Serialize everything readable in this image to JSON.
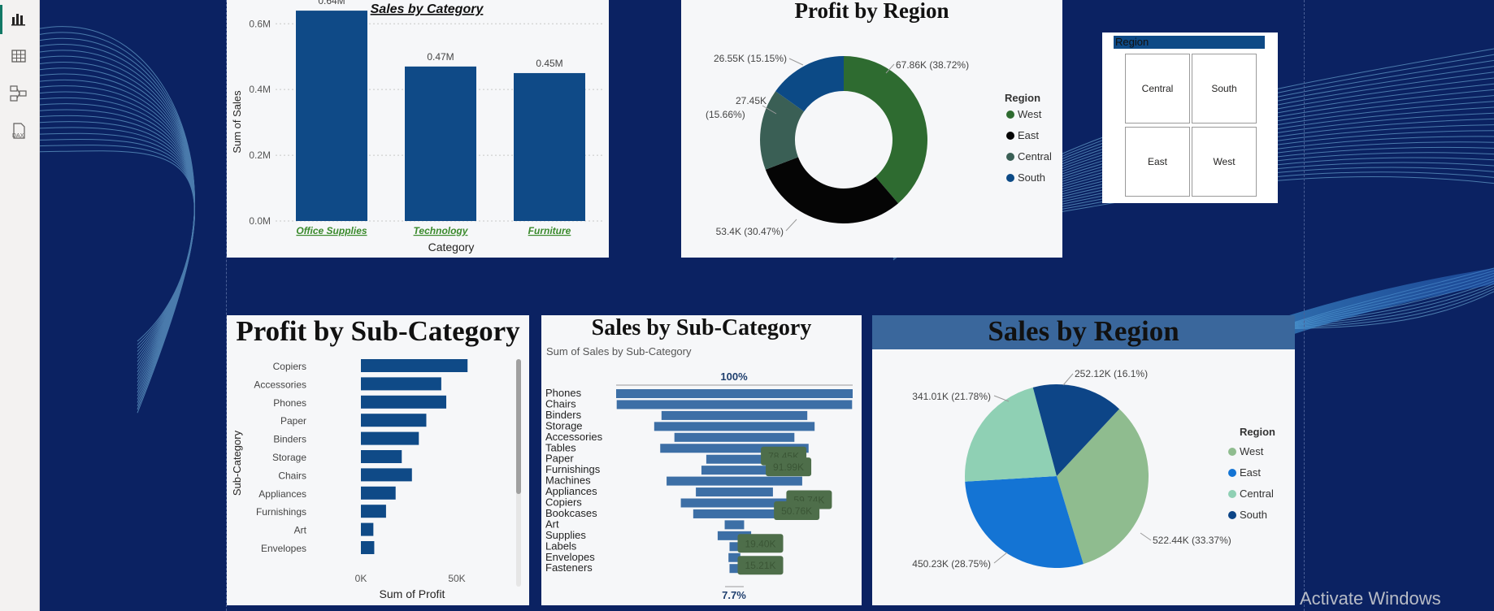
{
  "rail": {
    "items": [
      {
        "name": "report-view-icon",
        "active": true
      },
      {
        "name": "table-view-icon",
        "active": false
      },
      {
        "name": "model-view-icon",
        "active": false
      },
      {
        "name": "dax-query-view-icon",
        "active": false,
        "label": "DAX"
      }
    ]
  },
  "colors": {
    "canvas_bg": "#0b2262",
    "bar_dark": "#0f4a87",
    "funnel": "#3d6fa6",
    "west_green": "#2e6b30",
    "east_black": "#050505",
    "central_gray_green": "#3a5f55",
    "south_blue": "#0c4a86",
    "pie_west": "#8fbc8f",
    "pie_east": "#1474d4",
    "pie_central": "#8fd0b4",
    "pie_south": "#0d4587"
  },
  "sales_by_category": {
    "title": "Sales by Category",
    "ylabel": "Sum of Sales",
    "xlabel": "Category",
    "y_ticks": [
      "0.6M",
      "0.4M",
      "0.2M",
      "0.0M"
    ]
  },
  "profit_by_region": {
    "title": "Profit by Region",
    "legend_title": "Region",
    "labels": {
      "west": "67.86K (38.72%)",
      "east": "53.4K (30.47%)",
      "central_1": "27.45K",
      "central_2": "(15.66%)",
      "south": "26.55K (15.15%)"
    }
  },
  "region_slicer": {
    "header": "Region",
    "tiles": [
      "Central",
      "South",
      "East",
      "West"
    ]
  },
  "profit_by_subcategory": {
    "title": "Profit by Sub-Category",
    "ylabel": "Sub-Category",
    "xlabel": "Sum of Profit",
    "x_ticks": [
      "0K",
      "50K"
    ]
  },
  "sales_by_subcategory": {
    "title": "Sales by Sub-Category",
    "subtitle": "Sum of Sales by Sub-Category",
    "top_pct": "100%",
    "bottom_pct": "7.7%"
  },
  "sales_by_region": {
    "title": "Sales by Region",
    "legend_title": "Region",
    "labels": {
      "south": "252.12K (16.1%)",
      "central": "341.01K (21.78%)",
      "west": "522.44K (33.37%)",
      "east": "450.23K (28.75%)"
    }
  },
  "watermark": "Activate Windows",
  "chart_data": [
    {
      "type": "bar",
      "title": "Sales by Category",
      "xlabel": "Category",
      "ylabel": "Sum of Sales",
      "categories": [
        "Office Supplies",
        "Technology",
        "Furniture"
      ],
      "values": [
        0.64,
        0.47,
        0.45
      ],
      "data_labels": [
        "0.64M",
        "0.47M",
        "0.45M"
      ],
      "unit": "M",
      "ylim": [
        0,
        0.66
      ],
      "grid": true
    },
    {
      "type": "pie",
      "variant": "donut",
      "title": "Profit by Region",
      "categories": [
        "West",
        "East",
        "Central",
        "South"
      ],
      "values": [
        67.86,
        53.4,
        27.45,
        26.55
      ],
      "percents": [
        38.72,
        30.47,
        15.66,
        15.15
      ],
      "legend": "right"
    },
    {
      "type": "bar",
      "orientation": "horizontal",
      "title": "Profit by Sub-Category",
      "xlabel": "Sum of Profit",
      "ylabel": "Sub-Category",
      "categories": [
        "Copiers",
        "Accessories",
        "Phones",
        "Paper",
        "Binders",
        "Storage",
        "Chairs",
        "Appliances",
        "Furnishings",
        "Art",
        "Envelopes"
      ],
      "values": [
        55.6,
        41.9,
        44.5,
        34.1,
        30.2,
        21.3,
        26.6,
        18.1,
        13.1,
        6.5,
        6.96
      ],
      "xlim": [
        0,
        60
      ],
      "x_ticks": [
        "0K",
        "50K"
      ]
    },
    {
      "type": "bar",
      "variant": "funnel",
      "title": "Sales by Sub-Category",
      "subtitle": "Sum of Sales by Sub-Category",
      "categories": [
        "Phones",
        "Chairs",
        "Binders",
        "Storage",
        "Accessories",
        "Tables",
        "Paper",
        "Furnishings",
        "Machines",
        "Appliances",
        "Copiers",
        "Bookcases",
        "Art",
        "Supplies",
        "Labels",
        "Envelopes",
        "Fasteners"
      ],
      "values": [
        330.0,
        328.4,
        203.4,
        223.8,
        167.4,
        206.97,
        78.45,
        91.99,
        189.2,
        107.5,
        149.5,
        114.88,
        27.1,
        46.7,
        12.4,
        16.5,
        3.0
      ],
      "visible_data_labels": {
        "Paper": "78.45K",
        "Furnishings": "91.99K",
        "Copiers": "59.74K",
        "Bookcases": "50.76K",
        "Labels": "19.40K",
        "Fasteners": "15.21K"
      },
      "top_pct": "100%",
      "bottom_pct": "7.7%"
    },
    {
      "type": "pie",
      "title": "Sales by Region",
      "categories": [
        "West",
        "East",
        "Central",
        "South"
      ],
      "values": [
        522.44,
        450.23,
        341.01,
        252.12
      ],
      "percents": [
        33.37,
        28.75,
        21.78,
        16.1
      ],
      "legend": "right"
    }
  ]
}
